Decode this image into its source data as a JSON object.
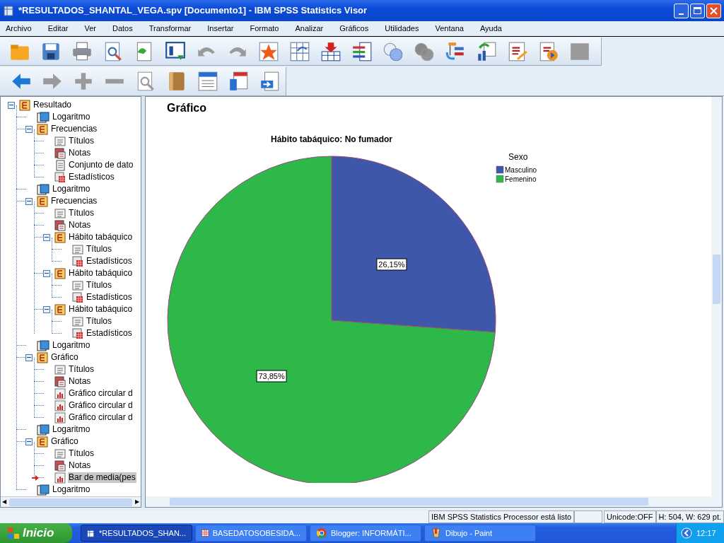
{
  "window": {
    "title": "*RESULTADOS_SHANTAL_VEGA.spv [Documento1] - IBM SPSS Statistics Visor"
  },
  "menu": [
    "Archivo",
    "Editar",
    "Ver",
    "Datos",
    "Transformar",
    "Insertar",
    "Formato",
    "Analizar",
    "Gráficos",
    "Utilidades",
    "Ventana",
    "Ayuda"
  ],
  "toolbar_1": [
    {
      "kind": "open",
      "disabled": false
    },
    {
      "kind": "save",
      "disabled": false
    },
    {
      "kind": "print",
      "disabled": false
    },
    {
      "kind": "preview",
      "disabled": false
    },
    {
      "kind": "export",
      "disabled": false
    },
    {
      "kind": "dialog",
      "disabled": false
    },
    {
      "kind": "undo",
      "disabled": true
    },
    {
      "kind": "redo",
      "disabled": true
    },
    {
      "kind": "star",
      "disabled": false
    },
    {
      "kind": "table",
      "disabled": false
    },
    {
      "kind": "insert",
      "disabled": false
    },
    {
      "kind": "variables",
      "disabled": false
    },
    {
      "kind": "circles",
      "disabled": false
    },
    {
      "kind": "circles",
      "disabled": true
    },
    {
      "kind": "outline",
      "disabled": false
    },
    {
      "kind": "chart",
      "disabled": false
    },
    {
      "kind": "edit",
      "disabled": false
    },
    {
      "kind": "run",
      "disabled": false
    },
    {
      "kind": "frame",
      "disabled": true
    }
  ],
  "toolbar_2": [
    {
      "kind": "back",
      "disabled": false
    },
    {
      "kind": "forward",
      "disabled": true
    },
    {
      "kind": "plus",
      "disabled": true
    },
    {
      "kind": "minus",
      "disabled": true
    },
    {
      "kind": "preview",
      "disabled": true
    },
    {
      "kind": "book",
      "disabled": false
    },
    {
      "kind": "heading",
      "disabled": false
    },
    {
      "kind": "promote",
      "disabled": false
    },
    {
      "kind": "demote",
      "disabled": false
    }
  ],
  "outline": [
    {
      "label": "Resultado",
      "kind": "folder",
      "expanded": true,
      "selected": false,
      "children": [
        {
          "label": "Logaritmo",
          "kind": "log",
          "selected": false
        },
        {
          "label": "Frecuencias",
          "kind": "folder",
          "expanded": true,
          "selected": false,
          "children": [
            {
              "label": "Títulos",
              "kind": "title",
              "selected": false
            },
            {
              "label": "Notas",
              "kind": "notes",
              "selected": false
            },
            {
              "label": "Conjunto de dato",
              "kind": "doc",
              "selected": false
            },
            {
              "label": "Estadísticos",
              "kind": "table",
              "selected": false
            }
          ]
        },
        {
          "label": "Logaritmo",
          "kind": "log",
          "selected": false
        },
        {
          "label": "Frecuencias",
          "kind": "folder",
          "expanded": true,
          "selected": false,
          "children": [
            {
              "label": "Títulos",
              "kind": "title",
              "selected": false
            },
            {
              "label": "Notas",
              "kind": "notes",
              "selected": false
            },
            {
              "label": "Hábito tabáquico",
              "kind": "folder",
              "expanded": true,
              "selected": false,
              "children": [
                {
                  "label": "Títulos",
                  "kind": "title",
                  "selected": false
                },
                {
                  "label": "Estadísticos",
                  "kind": "table",
                  "selected": false
                }
              ]
            },
            {
              "label": "Hábito tabáquico",
              "kind": "folder",
              "expanded": true,
              "selected": false,
              "children": [
                {
                  "label": "Títulos",
                  "kind": "title",
                  "selected": false
                },
                {
                  "label": "Estadísticos",
                  "kind": "table",
                  "selected": false
                }
              ]
            },
            {
              "label": "Hábito tabáquico",
              "kind": "folder",
              "expanded": true,
              "selected": false,
              "children": [
                {
                  "label": "Títulos",
                  "kind": "title",
                  "selected": false
                },
                {
                  "label": "Estadísticos",
                  "kind": "table",
                  "selected": false
                }
              ]
            }
          ]
        },
        {
          "label": "Logaritmo",
          "kind": "log",
          "selected": false
        },
        {
          "label": "Gráfico",
          "kind": "folder",
          "expanded": true,
          "selected": false,
          "children": [
            {
              "label": "Títulos",
              "kind": "title",
              "selected": false
            },
            {
              "label": "Notas",
              "kind": "notes",
              "selected": false
            },
            {
              "label": "Gráfico circular d",
              "kind": "chart",
              "selected": false
            },
            {
              "label": "Gráfico circular d",
              "kind": "chart",
              "selected": false
            },
            {
              "label": "Gráfico circular d",
              "kind": "chart",
              "selected": false
            }
          ]
        },
        {
          "label": "Logaritmo",
          "kind": "log",
          "selected": false
        },
        {
          "label": "Gráfico",
          "kind": "folder",
          "expanded": true,
          "selected": false,
          "children": [
            {
              "label": "Títulos",
              "kind": "title",
              "selected": false
            },
            {
              "label": "Notas",
              "kind": "notes",
              "selected": false
            },
            {
              "label": "Bar de media(pes",
              "kind": "chart",
              "selected": true
            }
          ]
        },
        {
          "label": "Logaritmo",
          "kind": "log",
          "selected": false
        }
      ]
    }
  ],
  "viewer": {
    "heading": "Gráfico",
    "chart_data": {
      "type": "pie",
      "title": "Hábito tabáquico: No fumador",
      "legend": "right",
      "categories": [
        "Masculino",
        "Femenino"
      ],
      "series": [
        {
          "name": "Sexo",
          "values": [
            26.15,
            73.85
          ]
        }
      ],
      "colors": [
        "#3f57a8",
        "#2fb84a"
      ],
      "value_labels": [
        "26,15%",
        "73,85%"
      ]
    }
  },
  "scroll_arrows": [
    "◀",
    "▶"
  ],
  "status_bar": [
    "IBM SPSS Statistics Processor está listo",
    "Unicode:OFF",
    "H: 504, W: 629 pt."
  ],
  "taskbar": {
    "start": "Inicio",
    "tasks": [
      {
        "label": "*RESULTADOS_SHAN...",
        "kind": "spss",
        "selected": true
      },
      {
        "label": "BASEDATOSOBESIDA...",
        "kind": "data",
        "selected": false
      },
      {
        "label": "Blogger: INFORMÁTI...",
        "kind": "browser",
        "selected": false
      },
      {
        "label": "Dibujo - Paint",
        "kind": "paint",
        "selected": false
      }
    ],
    "clock": "12:17"
  }
}
